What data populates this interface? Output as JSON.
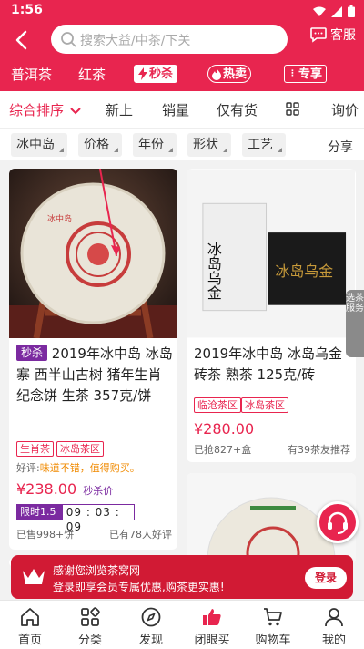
{
  "status_bar": {
    "time": "1:56"
  },
  "header": {
    "search_placeholder": "搜索大益/中茶/下关",
    "service_label": "客服"
  },
  "categories": {
    "puer": "普洱茶",
    "black": "红茶",
    "flash": "秒杀",
    "hot": "热卖",
    "exclusive": "专享"
  },
  "sort": {
    "comprehensive": "综合排序",
    "new": "新上",
    "sales": "销量",
    "in_stock": "仅有货",
    "inquiry": "询价"
  },
  "filters": {
    "chip1": "冰中岛",
    "chip2": "价格",
    "chip3": "年份",
    "chip4": "形状",
    "chip5": "工艺",
    "share": "分享"
  },
  "product1": {
    "badge": "秒杀",
    "title": "2019年冰中岛 冰岛寨 西半山古树 猪年生肖纪念饼 生茶 357克/饼",
    "tags": [
      "生肖茶",
      "冰岛茶区"
    ],
    "review_prefix": "好评:",
    "review_text": "味道不错，值得购买。",
    "price": "¥238.00",
    "price_label": "秒杀价",
    "discount": "限时1.5折",
    "countdown": "09 : 03 : 09",
    "sold": "已售998+饼",
    "good_reviews": "已有78人好评"
  },
  "product2": {
    "title": "2019年冰中岛 冰岛乌金砖茶 熟茶 125克/砖",
    "tags": [
      "临沧茶区",
      "冰岛茶区"
    ],
    "price": "¥280.00",
    "sold": "已抢827+盒",
    "recommend": "有39茶友推荐"
  },
  "product1_image": {
    "wrapper_text": "冰中岛"
  },
  "product2_image": {
    "box_text": "冰岛乌金",
    "dark_text": "冰岛乌金"
  },
  "side_tab": {
    "label": "选茶 服务"
  },
  "login_banner": {
    "line1": "感谢您浏览茶窝网",
    "line2": "登录即享会员专属优惠,购茶更实惠!",
    "button": "登录"
  },
  "tabs": {
    "home": "首页",
    "category": "分类",
    "discover": "发现",
    "buy": "闭眼买",
    "cart": "购物车",
    "mine": "我的"
  },
  "colors": {
    "brand": "#e8254f",
    "purple": "#7b2aa0"
  }
}
